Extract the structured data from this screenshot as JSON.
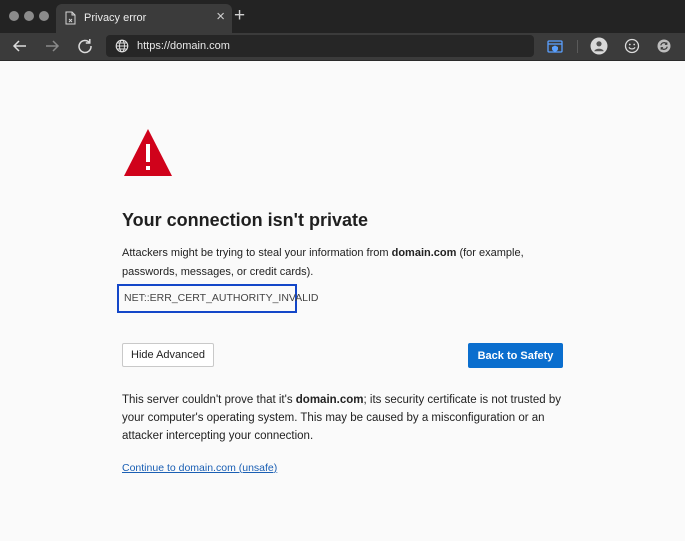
{
  "browser": {
    "tab_title": "Privacy error",
    "tab_close_glyph": "×",
    "new_tab_glyph": "+",
    "url": "https://domain.com",
    "icons": {
      "back": "arrow-left-icon",
      "forward": "arrow-right-icon",
      "refresh": "refresh-icon",
      "site_info": "globe-icon",
      "extension": "extension-icon",
      "profile": "profile-icon",
      "emoji": "smiley-icon",
      "sync": "sync-icon"
    }
  },
  "page": {
    "title": "Your connection isn't private",
    "intro_before": "Attackers might be trying to steal your information from ",
    "intro_domain": "domain.com",
    "intro_after": " (for example, passwords, messages, or credit cards).",
    "error_code": "NET::ERR_CERT_AUTHORITY_INVALID",
    "hide_advanced_label": "Hide Advanced",
    "back_to_safety_label": "Back to Safety",
    "advanced_before": "This server couldn't prove that it's ",
    "advanced_domain": "domain.com",
    "advanced_after": "; its security certificate is not trusted by your computer's operating system. This may be caused by a misconfiguration or an attacker intercepting your connection.",
    "continue_link": "Continue to domain.com (unsafe)"
  },
  "colors": {
    "warning_red": "#d0021b",
    "primary_blue": "#0a6ece",
    "highlight_blue": "#1346c8"
  }
}
